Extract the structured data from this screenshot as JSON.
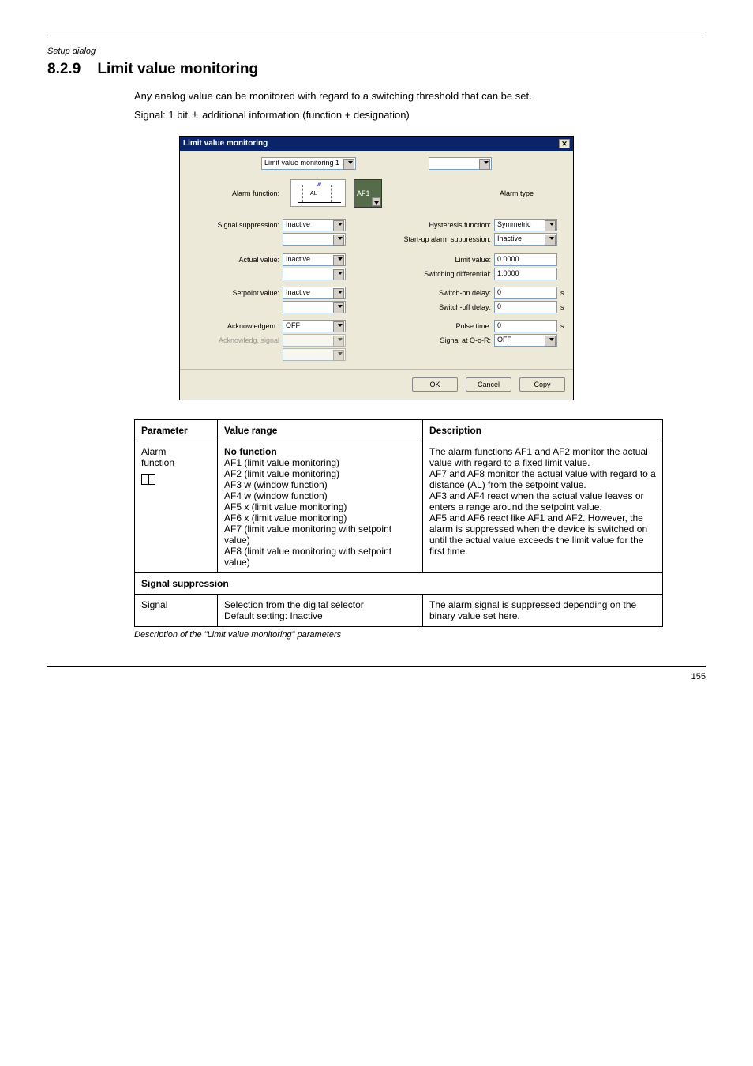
{
  "header": {
    "breadcrumb": "Setup dialog",
    "section_no": "8.2.9",
    "section_title": "Limit value monitoring",
    "intro": "Any analog value can be monitored with regard to a switching threshold that can be set.",
    "intro_sub_prefix": "Signal: 1 bit ",
    "intro_sub_suffix": " additional information (function + designation)"
  },
  "dialog": {
    "title": "Limit value monitoring",
    "instance": "Limit value monitoring 1",
    "alarm_function_label": "Alarm function:",
    "alarm_img_w": "w",
    "alarm_img_al": "AL",
    "af_code": "AF1",
    "alarm_type_label": "Alarm type",
    "left": {
      "signal_suppression_label": "Signal suppression:",
      "signal_suppression_value": "Inactive",
      "actual_value_label": "Actual value:",
      "actual_value_value": "Inactive",
      "setpoint_value_label": "Setpoint value:",
      "setpoint_value_value": "Inactive",
      "acknowledgement_label": "Acknowledgem.:",
      "acknowledgement_value": "OFF",
      "ack_signal_label": "Acknowledg. signal"
    },
    "right": {
      "hysteresis_function_label": "Hysteresis function:",
      "hysteresis_function_value": "Symmetric",
      "startup_suppression_label": "Start-up alarm suppression:",
      "startup_suppression_value": "Inactive",
      "limit_value_label": "Limit value:",
      "limit_value_value": "0.0000",
      "switching_diff_label": "Switching differential:",
      "switching_diff_value": "1.0000",
      "switch_on_delay_label": "Switch-on delay:",
      "switch_on_delay_value": "0",
      "switch_off_delay_label": "Switch-off delay:",
      "switch_off_delay_value": "0",
      "pulse_time_label": "Pulse time:",
      "pulse_time_value": "0",
      "signal_oor_label": "Signal at O-o-R:",
      "signal_oor_value": "OFF",
      "unit_s": "s"
    },
    "buttons": {
      "ok": "OK",
      "cancel": "Cancel",
      "copy": "Copy"
    }
  },
  "table": {
    "headers": {
      "parameter": "Parameter",
      "range": "Value range",
      "description": "Description"
    },
    "rows": [
      {
        "param_lines": [
          "Alarm",
          "function"
        ],
        "book": true,
        "range_lines": [
          "No function",
          "AF1 (limit value monitoring)",
          "AF2 (limit value monitoring)",
          "AF3 w (window function)",
          "AF4 w (window function)",
          "AF5 x (limit value monitoring)",
          "AF6 x (limit value monitoring)",
          "AF7 (limit value monitoring with setpoint value)",
          "AF8 (limit value monitoring with setpoint value)"
        ],
        "desc_lines": [
          "The alarm functions AF1 and AF2 monitor the actual value with regard to a fixed limit value.",
          "AF7 and AF8 monitor the actual value with regard to a distance (AL) from the setpoint value.",
          "AF3 and AF4 react when the actual value leaves or enters a range around the setpoint value.",
          "AF5 and AF6 react like AF1 and AF2. However, the alarm is suppressed when the device is switched on until the actual value exceeds the limit value for the first time."
        ]
      }
    ],
    "subheader": "Signal suppression",
    "sub_rows": [
      {
        "param": "Signal",
        "range_lines": [
          "Selection from the digital selector",
          "Default setting: Inactive"
        ],
        "desc": "The alarm signal is suppressed depending on the binary value set here."
      }
    ],
    "continuation": "Description of the \"Limit value monitoring\" parameters"
  },
  "footer": {
    "page": "155"
  }
}
